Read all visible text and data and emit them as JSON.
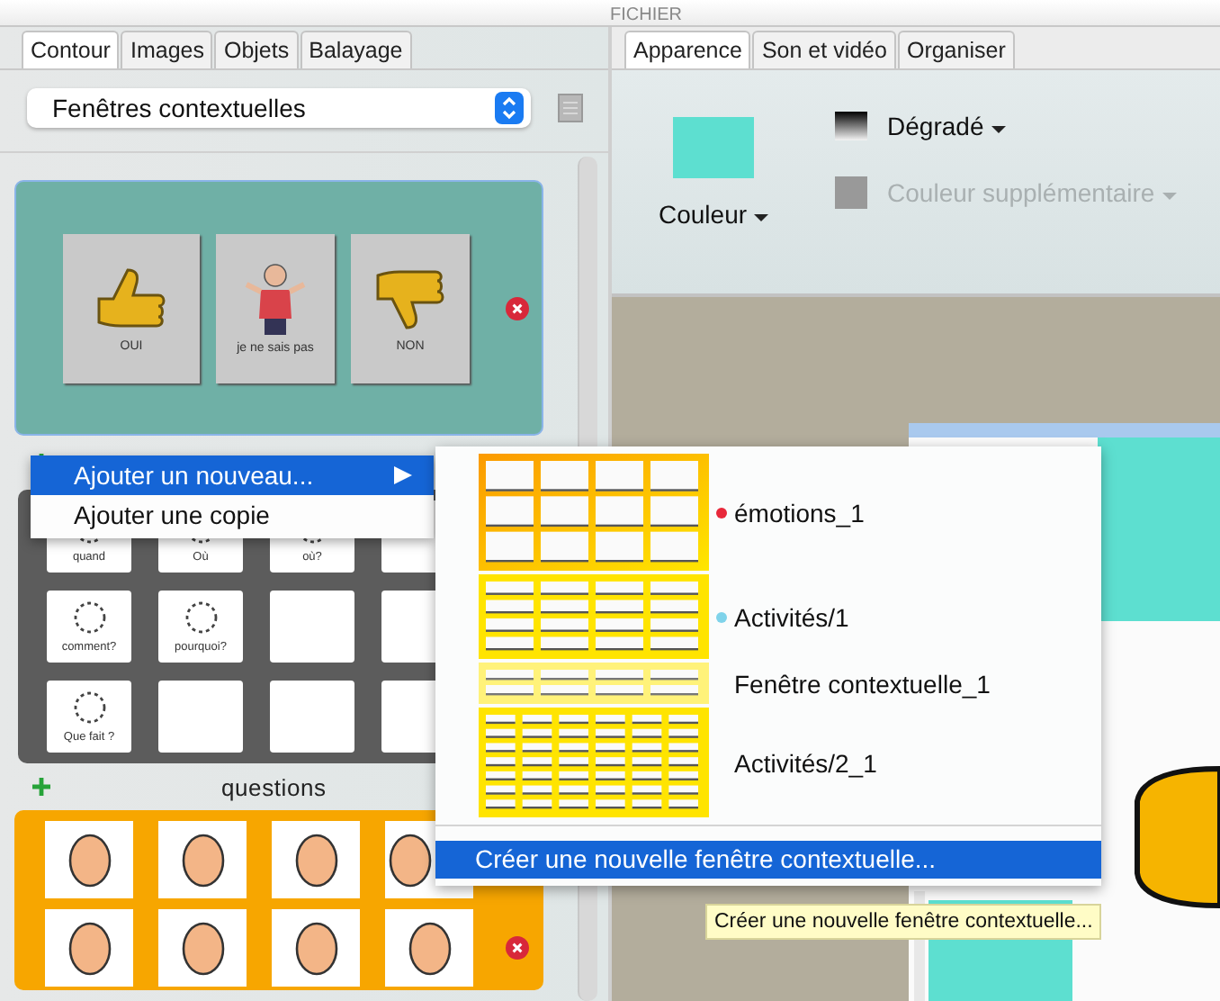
{
  "title": "FICHIER",
  "left_tabs": [
    {
      "label": "Contour",
      "selected": true
    },
    {
      "label": "Images",
      "selected": false
    },
    {
      "label": "Objets",
      "selected": false
    },
    {
      "label": "Balayage",
      "selected": false
    }
  ],
  "category_select": {
    "value": "Fenêtres contextuelles"
  },
  "popups": [
    {
      "color": "#6fb0a6",
      "cells": [
        {
          "kind": "thumb-up",
          "label": "OUI"
        },
        {
          "kind": "figure",
          "label": "je ne sais pas"
        },
        {
          "kind": "thumb-down",
          "label": "NON"
        }
      ]
    },
    {
      "color": "#5c5c5c",
      "title": "questions",
      "cells": [
        {
          "kind": "question",
          "label": "quand"
        },
        {
          "kind": "question",
          "label": "Où"
        },
        {
          "kind": "question",
          "label": "où?"
        },
        {
          "kind": "blank"
        },
        {
          "kind": "question",
          "label": "comment?"
        },
        {
          "kind": "question",
          "label": "pourquoi?"
        },
        {
          "kind": "blank"
        },
        {
          "kind": "blank"
        },
        {
          "kind": "question",
          "label": "Que fait ?"
        },
        {
          "kind": "blank"
        },
        {
          "kind": "blank"
        },
        {
          "kind": "blank"
        }
      ]
    },
    {
      "color": "#f7a600",
      "cells": [
        {
          "kind": "face"
        },
        {
          "kind": "face"
        },
        {
          "kind": "face"
        },
        {
          "kind": "face"
        },
        {
          "kind": "face"
        },
        {
          "kind": "face"
        },
        {
          "kind": "face"
        },
        {
          "kind": "face"
        }
      ]
    }
  ],
  "context_menu": {
    "items": [
      {
        "label": "Ajouter un nouveau...",
        "selected": true,
        "submenu": true
      },
      {
        "label": "Ajouter une copie",
        "selected": false,
        "submenu": false
      }
    ]
  },
  "submenu": {
    "items": [
      {
        "label": "émotions_1",
        "color": "#e8283a"
      },
      {
        "label": "Activités/1",
        "color": "#7fd3ea"
      },
      {
        "label": "Fenêtre contextuelle_1"
      },
      {
        "label": "Activités/2_1"
      }
    ],
    "action": {
      "label": "Créer une nouvelle fenêtre contextuelle...",
      "selected": true
    }
  },
  "tooltip": "Créer une nouvelle fenêtre contextuelle...",
  "right_tabs": [
    {
      "label": "Apparence",
      "selected": true
    },
    {
      "label": "Son et vidéo",
      "selected": false
    },
    {
      "label": "Organiser",
      "selected": false
    }
  ],
  "appearance": {
    "fill": {
      "label": "Couleur",
      "color": "#5ddfd0"
    },
    "gradient": {
      "label": "Dégradé"
    },
    "extra_color": {
      "label": "Couleur supplémentaire",
      "disabled": true
    }
  }
}
